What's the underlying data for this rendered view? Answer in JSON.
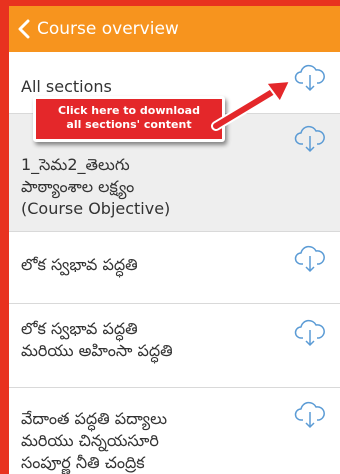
{
  "colors": {
    "header_bg": "#f7941e",
    "frame": "#e8321f",
    "callout_bg": "#e4272a",
    "selected_row_bg": "#eeeeee",
    "icon_blue": "#5b9bd5"
  },
  "header": {
    "back_icon": "chevron-left-icon",
    "title": "Course overview"
  },
  "sections": {
    "all": {
      "label": "All sections",
      "icon": "cloud-download-icon"
    },
    "objective": {
      "label_line1": "1_సెమ2_తెలుగు",
      "label_line2": "పాఠ్యాంశాల లక్ష్యం",
      "label_line3": "(Course Objective)",
      "icon": "cloud-download-icon"
    },
    "items": [
      {
        "line1": "లోక స్వభావ పద్ధతి",
        "icon": "cloud-download-icon"
      },
      {
        "line1": "లోక స్వభావ పద్ధతి",
        "line2": "మరియు అహింసా పద్ధతి",
        "icon": "cloud-download-icon"
      },
      {
        "line1": "వేదాంత పద్ధతి పద్యాలు",
        "line2": "మరియు చిన్నయసూరి",
        "line3": "సంపూర్ణ నీతి చంద్రిక",
        "icon": "cloud-download-icon"
      }
    ]
  },
  "callout": {
    "line1": "Click here to download",
    "line2": "all sections' content"
  }
}
